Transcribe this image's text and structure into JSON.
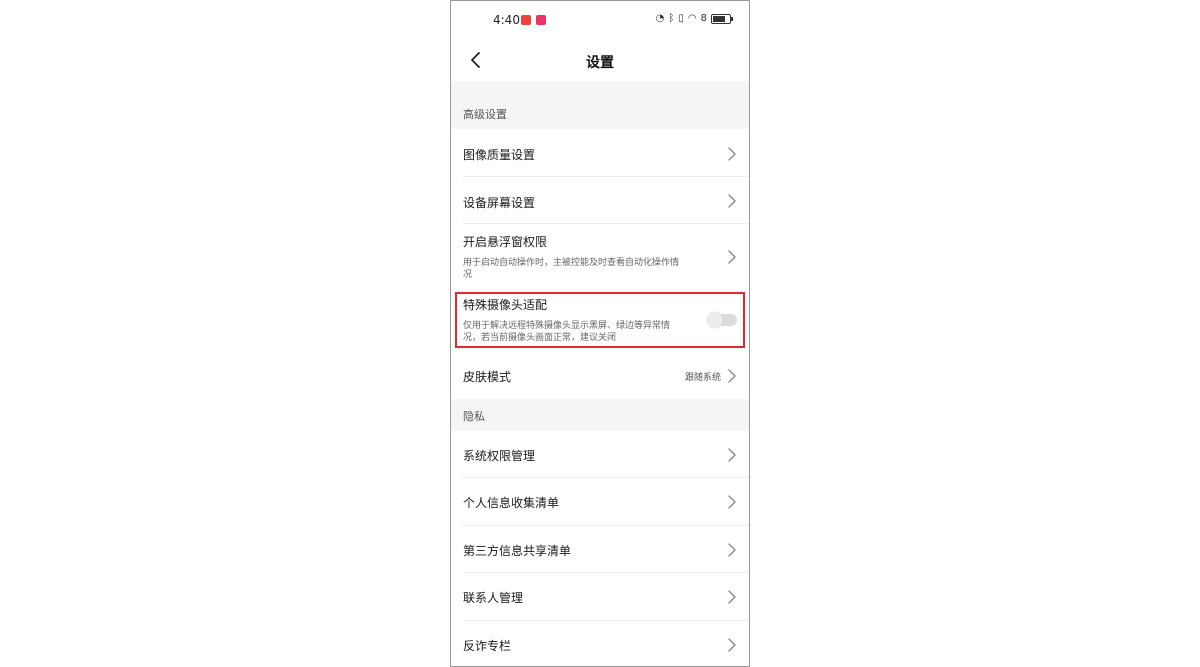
{
  "status_bar": {
    "time": "4:40",
    "battery_label": "8"
  },
  "header": {
    "title": "设置",
    "back_icon": "chevron-left-icon"
  },
  "sections": [
    {
      "title": "高级设置",
      "items": [
        {
          "label": "图像质量设置"
        },
        {
          "label": "设备屏幕设置"
        },
        {
          "label": "开启悬浮窗权限",
          "description": "用于启动自动操作时，主被控能及时查看自动化操作情况"
        },
        {
          "label": "特殊摄像头适配",
          "description": "仅用于解决远程特殊摄像头显示黑屏、绿边等异常情况，若当前摄像头画面正常，建议关闭",
          "toggle_on": false
        },
        {
          "label": "皮肤模式",
          "value": "跟随系统"
        }
      ]
    },
    {
      "title": "隐私",
      "items": [
        {
          "label": "系统权限管理"
        },
        {
          "label": "个人信息收集清单"
        },
        {
          "label": "第三方信息共享清单"
        },
        {
          "label": "联系人管理"
        },
        {
          "label": "反诈专栏"
        }
      ]
    }
  ],
  "colors": {
    "highlight_border": "#e0282e",
    "section_background": "#f5f5f5"
  }
}
